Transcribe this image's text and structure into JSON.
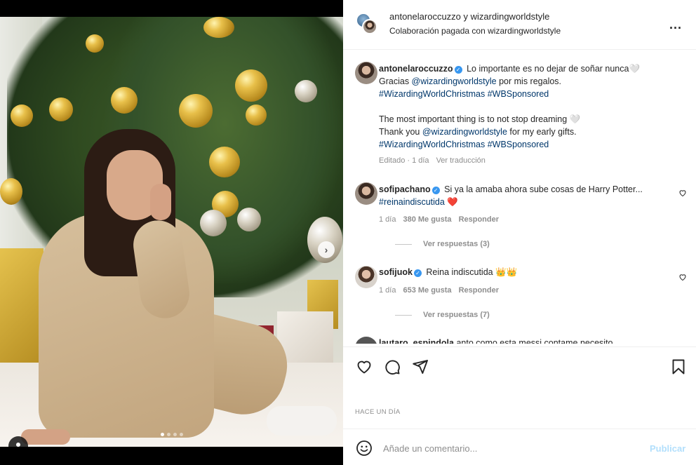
{
  "header": {
    "title_user1": "antonelaroccuzzo",
    "title_conj": " y ",
    "title_user2": "wizardingworldstyle",
    "sub_prefix": "Colaboración pagada con ",
    "sub_partner": "wizardingworldstyle",
    "more_label": "..."
  },
  "caption": {
    "username": "antonelaroccuzzo",
    "line1": "Lo importante es no dejar de soñar nunca🤍",
    "line2_a": "Gracias ",
    "line2_mention": "@wizardingworldstyle",
    "line2_b": " por mis regalos.",
    "line3_tag1": "#WizardingWorldChristmas",
    "line3_tag2": "#WBSponsored",
    "line4": "The most important thing is to not stop dreaming 🤍",
    "line5_a": "Thank you ",
    "line5_mention": "@wizardingworldstyle",
    "line5_b": " for my early gifts.",
    "line6_tag1": "#WizardingWorldChristmas",
    "line6_tag2": "#WBSponsored",
    "edited": "Editado · 1 día",
    "translate": "Ver traducción"
  },
  "comments": [
    {
      "username": "sofipachano",
      "text_a": "Si ya la amaba ahora sube cosas de Harry Potter... ",
      "tag": "#reinaindiscutida",
      "text_b": " ❤️",
      "time": "1 día",
      "likes": "380 Me gusta",
      "reply": "Responder",
      "view_replies": "Ver respuestas (3)"
    },
    {
      "username": "sofijuok",
      "text_a": "Reina indiscutida 👑👑",
      "tag": "",
      "text_b": "",
      "time": "1 día",
      "likes": "653 Me gusta",
      "reply": "Responder",
      "view_replies": "Ver respuestas (7)"
    },
    {
      "username": "lautaro_espindola",
      "text_a": "anto como esta messi contame necesito",
      "tag": "",
      "text_b": "",
      "time": "",
      "likes": "",
      "reply": "",
      "view_replies": ""
    }
  ],
  "post": {
    "timestamp": "HACE UN DÍA",
    "carousel": {
      "current_slide": 1,
      "total_slides": 4
    }
  },
  "comment_box": {
    "placeholder": "Añade un comentario...",
    "publish_label": "Publicar"
  },
  "icons": {
    "like": "heart-icon",
    "comment": "comment-icon",
    "share": "send-icon",
    "save": "bookmark-icon",
    "emoji": "emoji-icon",
    "next": "chevron-right-icon",
    "tagged_users": "user-tag-icon"
  },
  "colors": {
    "verified_blue": "#3897f0",
    "link": "#00376b",
    "muted": "#8e8e8e",
    "publish_disabled": "#b2dffc",
    "heart_red": "#ed4956"
  }
}
